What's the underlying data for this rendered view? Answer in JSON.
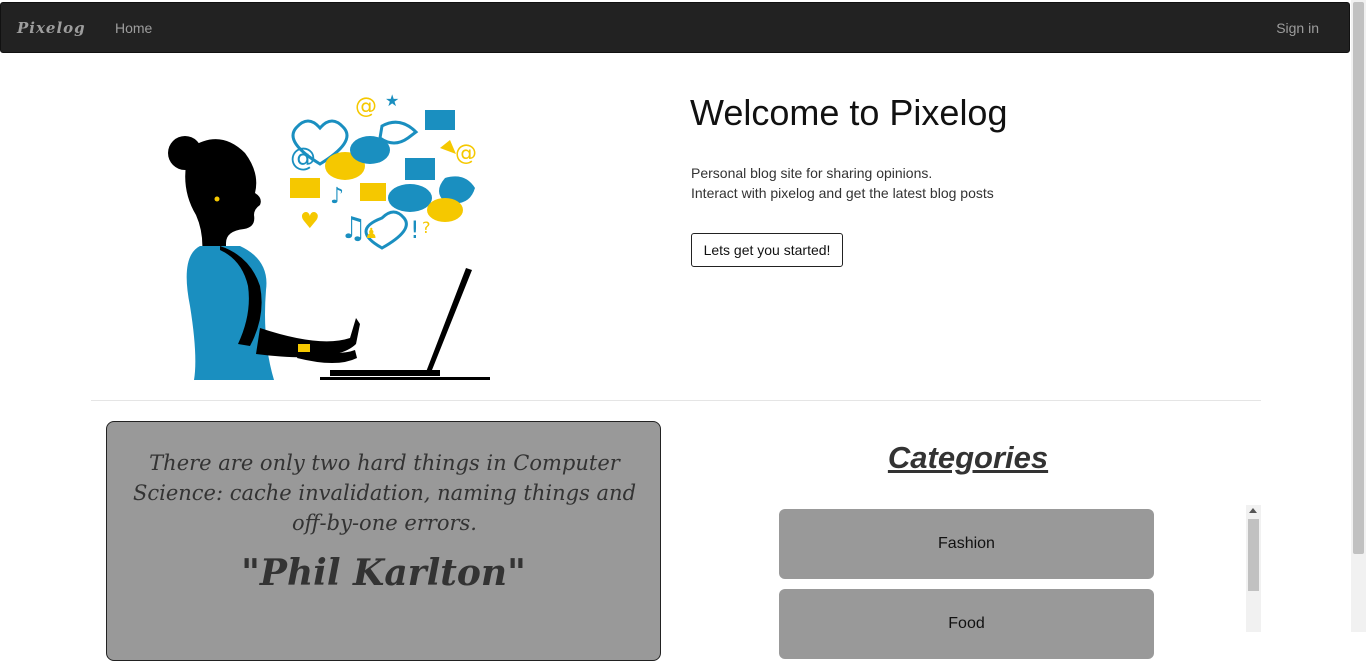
{
  "navbar": {
    "brand": "Pixelog",
    "home": "Home",
    "signin": "Sign in"
  },
  "hero": {
    "title": "Welcome to Pixelog",
    "line1": "Personal blog site for sharing opinions.",
    "line2": "Interact with pixelog and get the latest blog posts",
    "button": "Lets get you started!"
  },
  "quote": {
    "text": "There are only two hard things in Computer Science: cache invalidation, naming things and off-by-one errors.",
    "author": "\"Phil Karlton\""
  },
  "categories": {
    "heading": "Categories",
    "items": [
      {
        "label": "Fashion"
      },
      {
        "label": "Food"
      }
    ]
  },
  "colors": {
    "navbar": "#222222",
    "card": "#999999",
    "accent_blue": "#1a8fc0",
    "accent_yellow": "#f5c800"
  }
}
